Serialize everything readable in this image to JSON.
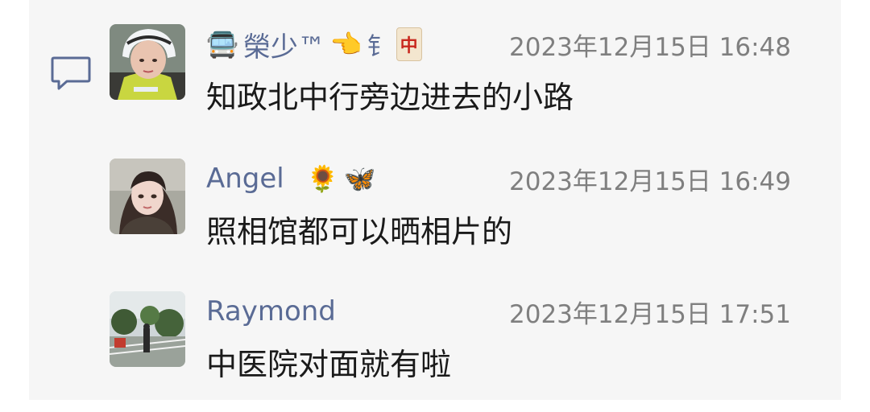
{
  "comments": [
    {
      "name": "榮少™",
      "name_prefix_icon": "bus-emoji",
      "name_badges": [
        "👈",
        "钅",
        "🀄"
      ],
      "time": "2023年12月15日 16:48",
      "text": "知政北中行旁边进去的小路"
    },
    {
      "name": "Angel",
      "name_badges": [
        "🌻",
        "🦋"
      ],
      "time": "2023年12月15日 16:49",
      "text": "照相馆都可以晒相片的"
    },
    {
      "name": "Raymond",
      "name_badges": [],
      "time": "2023年12月15日 17:51",
      "text": "中医院对面就有啦"
    }
  ],
  "colors": {
    "panel_bg": "#f6f6f6",
    "name": "#5a6b95",
    "time": "#7f7f7f",
    "text": "#1a1a1a",
    "comment_icon": "#5a6b95"
  }
}
